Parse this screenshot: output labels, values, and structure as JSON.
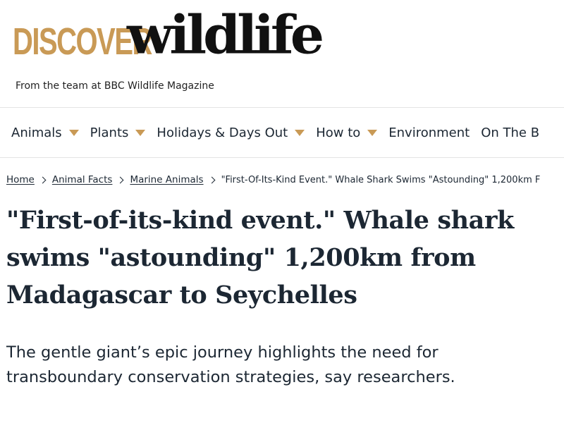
{
  "site": {
    "logo_discover": "DISCOVER",
    "logo_wildlife": "wildlife",
    "tagline": "From the team at BBC Wildlife Magazine"
  },
  "nav": {
    "items": [
      {
        "label": "Animals",
        "has_dropdown": true
      },
      {
        "label": "Plants",
        "has_dropdown": true
      },
      {
        "label": "Holidays & Days Out",
        "has_dropdown": true
      },
      {
        "label": "How to",
        "has_dropdown": true
      },
      {
        "label": "Environment",
        "has_dropdown": false
      },
      {
        "label": "On The B",
        "has_dropdown": false
      }
    ]
  },
  "breadcrumb": {
    "items": [
      {
        "label": "Home"
      },
      {
        "label": "Animal Facts"
      },
      {
        "label": "Marine Animals"
      }
    ],
    "current": "\"First-Of-Its-Kind Event.\" Whale Shark Swims \"Astounding\" 1,200km F"
  },
  "article": {
    "headline": "\"First-of-its-kind event.\" Whale shark swims \"astounding\" 1,200km from Madagascar to Seychelles",
    "standfirst": "The gentle giant’s epic journey highlights the need for transboundary conservation strategies, say researchers."
  },
  "colors": {
    "accent_gold": "#c99a56",
    "text_dark": "#1c2733",
    "logo_black": "#111111",
    "divider": "#e4e4e4"
  }
}
